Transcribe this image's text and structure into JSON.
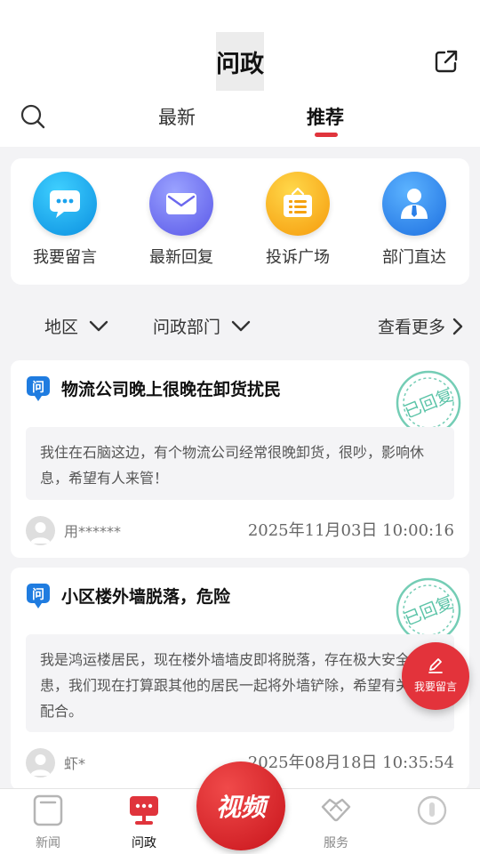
{
  "header": {
    "title": "问政"
  },
  "tabs": [
    {
      "label": "最新"
    },
    {
      "label": "推荐"
    }
  ],
  "quick_actions": [
    {
      "label": "我要留言",
      "icon": "chat-bubble-icon"
    },
    {
      "label": "最新回复",
      "icon": "envelope-icon"
    },
    {
      "label": "投诉广场",
      "icon": "notice-board-icon"
    },
    {
      "label": "部门直达",
      "icon": "person-icon"
    }
  ],
  "filters": {
    "region": "地区",
    "department": "问政部门",
    "more": "查看更多"
  },
  "posts": [
    {
      "title": "物流公司晚上很晚在卸货扰民",
      "body": "我住在石脑这边，有个物流公司经常很晚卸货，很吵，影响休息，希望有人来管！",
      "user": "用******",
      "time": "2025年11月03日 10:00:16",
      "stamp": "已回复"
    },
    {
      "title": "小区楼外墙脱落，危险",
      "body": "我是鸿运楼居民，现在楼外墙墙皮即将脱落，存在极大安全隐患，我们现在打算跟其他的居民一起将外墙铲除，希望有关部门配合。",
      "user": "虾*",
      "time": "2025年08月18日 10:35:54",
      "stamp": "已回复"
    }
  ],
  "fab": {
    "label": "我要留言"
  },
  "bottom_nav": [
    {
      "label": "新闻"
    },
    {
      "label": "问政"
    },
    {
      "label": "视频"
    },
    {
      "label": "服务"
    },
    {
      "label": ""
    }
  ],
  "colors": {
    "accent": "#e0343c",
    "stamp": "#5cc4a8"
  }
}
